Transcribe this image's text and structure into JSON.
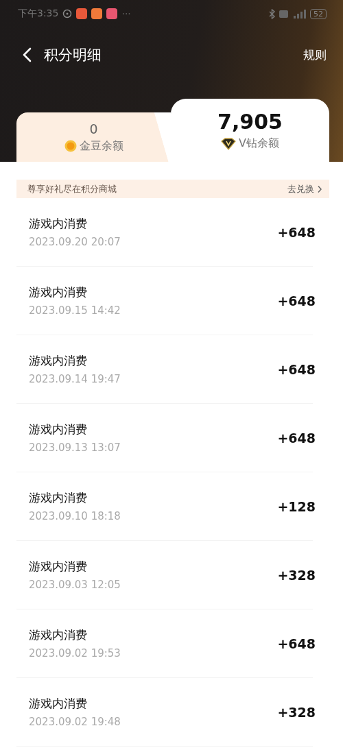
{
  "status_bar": {
    "time": "下午3:35",
    "more": "···",
    "battery": "52"
  },
  "header": {
    "title": "积分明细",
    "rules_link": "规则"
  },
  "balance_tabs": [
    {
      "kind": "coin",
      "amount": "0",
      "label": "金豆余额",
      "selected": false
    },
    {
      "kind": "diamond",
      "amount": "7,905",
      "label": "V钻余额",
      "selected": true
    }
  ],
  "promo_banner": {
    "text": "尊享好礼尽在积分商城",
    "action": "去兑换"
  },
  "records": [
    {
      "title": "游戏内消费",
      "time": "2023.09.20 20:07",
      "amount": "+648"
    },
    {
      "title": "游戏内消费",
      "time": "2023.09.15 14:42",
      "amount": "+648"
    },
    {
      "title": "游戏内消费",
      "time": "2023.09.14 19:47",
      "amount": "+648"
    },
    {
      "title": "游戏内消费",
      "time": "2023.09.13 13:07",
      "amount": "+648"
    },
    {
      "title": "游戏内消费",
      "time": "2023.09.10 18:18",
      "amount": "+128"
    },
    {
      "title": "游戏内消费",
      "time": "2023.09.03 12:05",
      "amount": "+328"
    },
    {
      "title": "游戏内消费",
      "time": "2023.09.02 19:53",
      "amount": "+648"
    },
    {
      "title": "游戏内消费",
      "time": "2023.09.02 19:48",
      "amount": "+328"
    }
  ]
}
